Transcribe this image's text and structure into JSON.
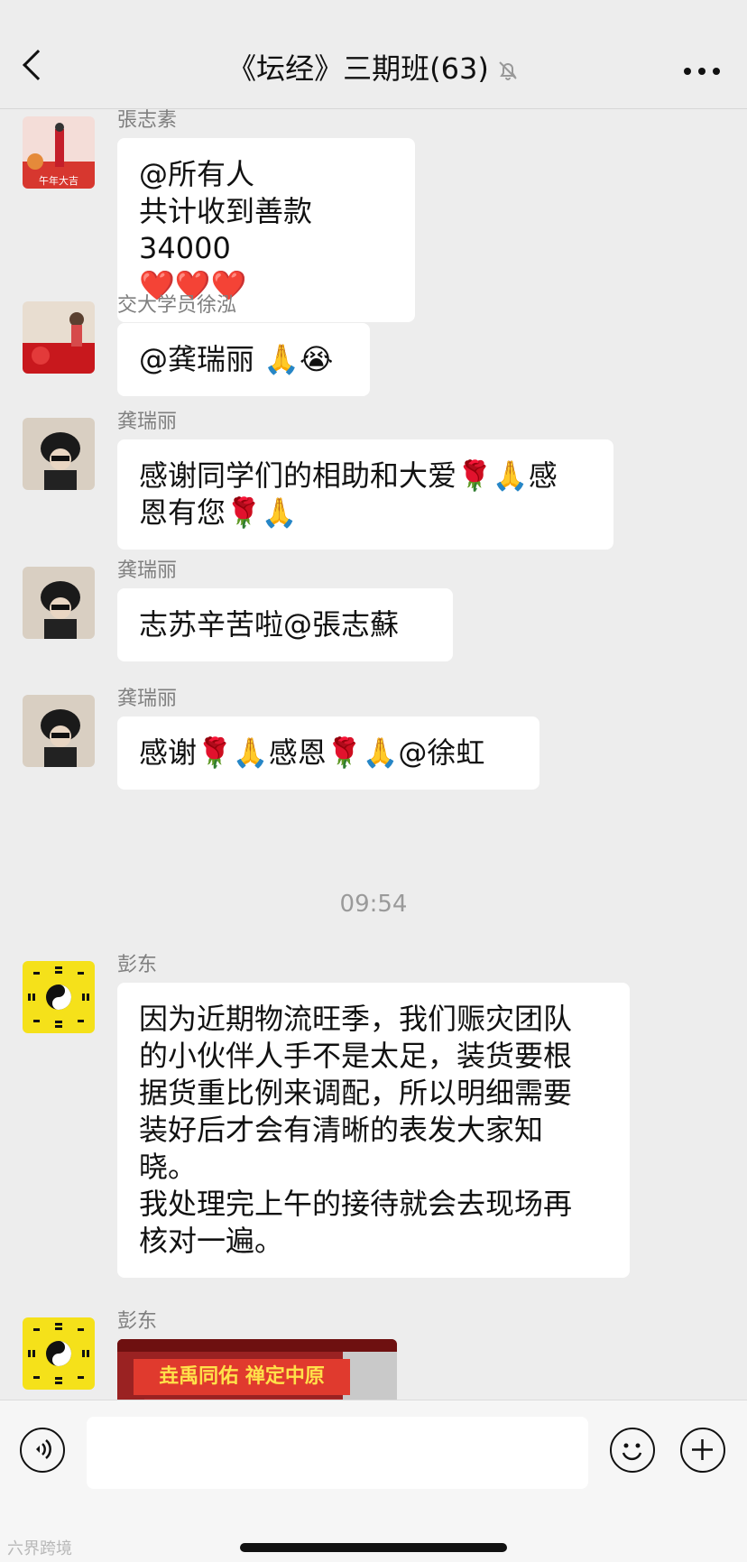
{
  "header": {
    "title": "《坛经》三期班(63)",
    "back_icon": "chevron-left-icon",
    "mute_icon": "bell-slash-icon",
    "more_icon": "more-horizontal-icon"
  },
  "messages": [
    {
      "sender": "張志素",
      "text": "@所有人\n共计收到善款 34000\n❤️❤️❤️"
    },
    {
      "sender": "交大学员徐泓",
      "text": "@龚瑞丽 🙏😭"
    },
    {
      "sender": "龚瑞丽",
      "text": "感谢同学们的相助和大爱🌹🙏感\n恩有您🌹🙏"
    },
    {
      "sender": "龚瑞丽",
      "text": "志苏辛苦啦@張志蘇"
    },
    {
      "sender": "龚瑞丽",
      "text": "感谢🌹🙏感恩🌹🙏@徐虹"
    }
  ],
  "timestamp": "09:54",
  "messages2": [
    {
      "sender": "彭东",
      "text": "因为近期物流旺季，我们赈灾团队\n的小伙伴人手不是太足，装货要根\n据货重比例来调配，所以明细需要\n装好后才会有清晰的表发大家知\n晓。\n我处理完上午的接待就会去现场再\n核对一遍。"
    },
    {
      "sender": "彭东",
      "image_banner_text": "垚禹同佑 禅定中原"
    }
  ],
  "footer": {
    "voice_icon": "voice-icon",
    "emoji_icon": "emoji-icon",
    "plus_icon": "plus-icon",
    "watermark": "六界跨境"
  }
}
